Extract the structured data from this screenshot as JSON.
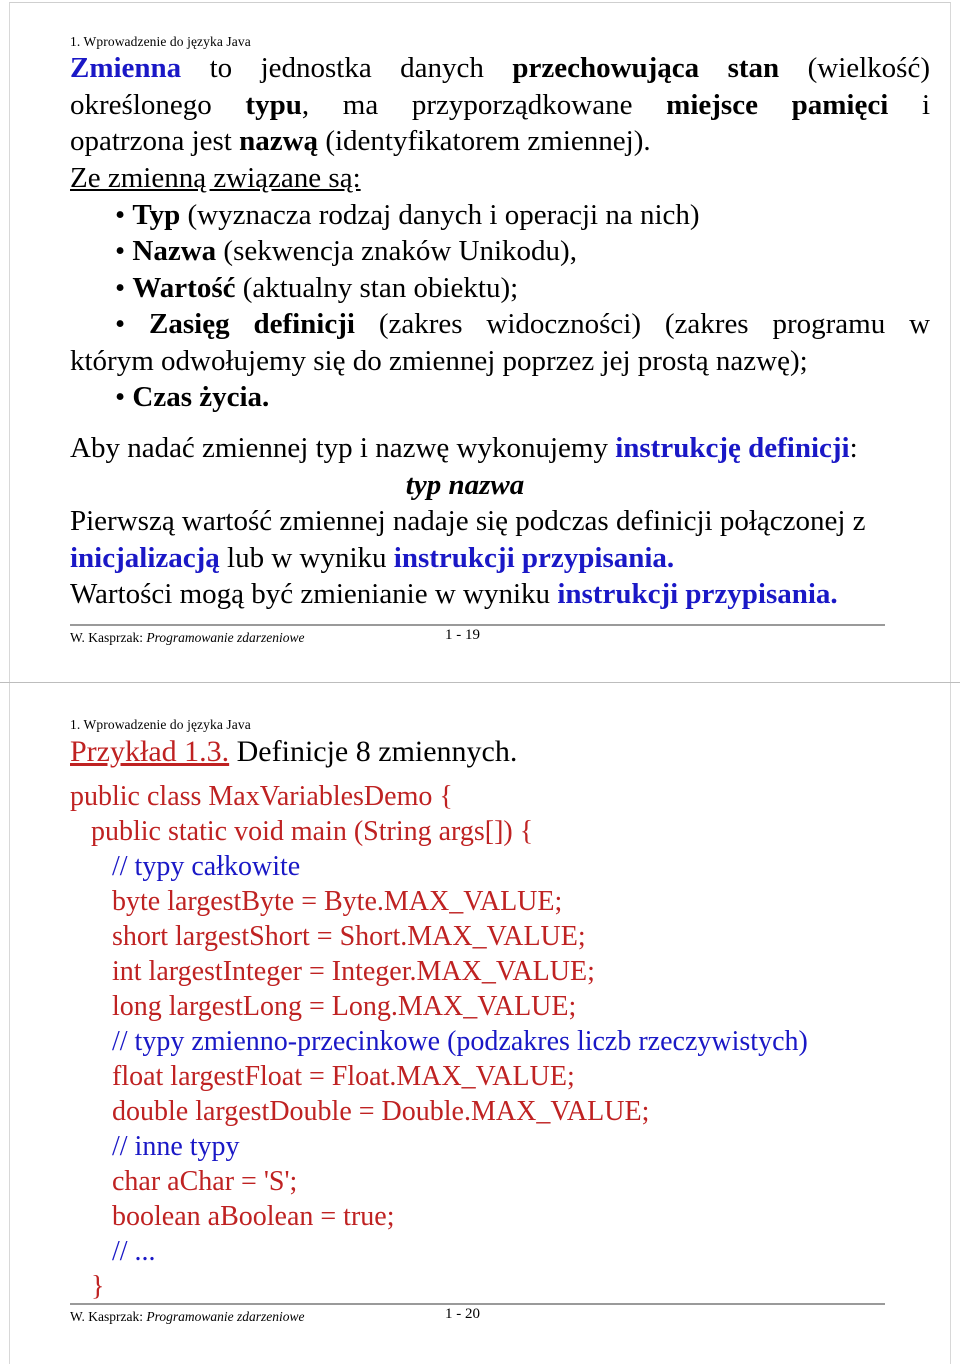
{
  "document": {
    "slides": [
      {
        "kicker": "1. Wprowadzenie do języka Java",
        "paragraph": {
          "l1_a": "Zmienna",
          "l1_b": " to jednostka danych ",
          "l1_c": "przechowująca stan",
          "l1_d": " (wielkość)",
          "l2_a": "określonego ",
          "l2_b": "typu",
          "l2_c": ", ma przyporządkowane ",
          "l2_d": "miejsce pamięci",
          "l2_e": " i",
          "l3_a": "opatrzona jest ",
          "l3_b": "nazwą",
          "l3_c": " (identyfikatorem zmiennej)."
        },
        "list_heading": "Ze zmienną związane są:",
        "bullets": [
          {
            "bold": "Typ",
            "rest": " (wyznacza rodzaj danych i operacji na nich)"
          },
          {
            "bold": "Nazwa",
            "rest": " (sekwencja znaków Unikodu),"
          },
          {
            "bold": "Wartość",
            "rest": " (aktualny stan obiektu);"
          },
          {
            "bold": "Zasięg definicji",
            "rest": " (zakres widoczności) (zakres programu w",
            "cont": "którym odwołujemy się do zmiennej poprzez jej prostą nazwę);"
          },
          {
            "bold": "Czas życia.",
            "rest": ""
          }
        ],
        "closing": {
          "l1_a": "Aby nadać zmiennej typ i nazwę wykonujemy ",
          "l1_b": "instrukcję definicji",
          "l1_c": ":",
          "syntax": "typ nazwa",
          "l2": "Pierwszą wartość zmiennej nadaje się podczas definicji połączonej z",
          "l3_a": "inicjalizacją",
          "l3_b": " lub w wyniku ",
          "l3_c": "instrukcji przypisania.",
          "l4_a": "Wartości mogą być zmienianie w wyniku ",
          "l4_b": "instrukcji przypisania."
        },
        "footer": {
          "author": "W. Kasprzak: ",
          "course": "Programowanie zdarzeniowe",
          "page": "1 - 19"
        }
      },
      {
        "kicker": "1. Wprowadzenie do języka Java",
        "title": {
          "example": "Przykład 1.3.",
          "rest": " Definicje 8 zmiennych."
        },
        "code": [
          {
            "text": "public class MaxVariablesDemo {",
            "kind": "code"
          },
          {
            "text": "   public static void main (String args[]) {",
            "kind": "code"
          },
          {
            "text": "      // typy całkowite",
            "kind": "comment"
          },
          {
            "text": "      byte largestByte = Byte.MAX_VALUE;",
            "kind": "code"
          },
          {
            "text": "      short largestShort = Short.MAX_VALUE;",
            "kind": "code"
          },
          {
            "text": "      int largestInteger = Integer.MAX_VALUE;",
            "kind": "code"
          },
          {
            "text": "      long largestLong = Long.MAX_VALUE;",
            "kind": "code"
          },
          {
            "text": "      // typy zmienno-przecinkowe (podzakres liczb rzeczywistych)",
            "kind": "comment"
          },
          {
            "text": "      float largestFloat = Float.MAX_VALUE;",
            "kind": "code"
          },
          {
            "text": "      double largestDouble = Double.MAX_VALUE;",
            "kind": "code"
          },
          {
            "text": "      // inne typy",
            "kind": "comment"
          },
          {
            "text": "      char aChar = 'S';",
            "kind": "code"
          },
          {
            "text": "      boolean aBoolean = true;",
            "kind": "code"
          },
          {
            "text": "      // ...",
            "kind": "comment"
          },
          {
            "text": "   }",
            "kind": "code"
          }
        ],
        "footer": {
          "author": "W. Kasprzak: ",
          "course": "Programowanie zdarzeniowe",
          "page": "1 - 20"
        }
      }
    ]
  }
}
